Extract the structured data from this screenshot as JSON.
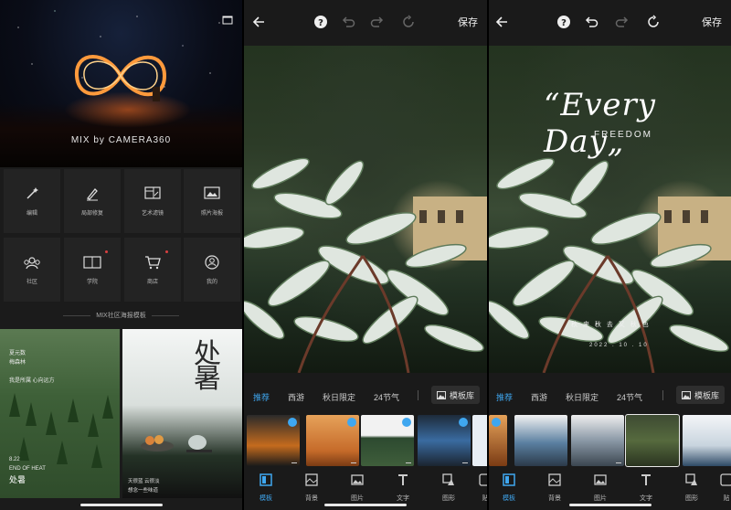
{
  "home": {
    "brand": "MIX by CAMERA360",
    "tools": [
      {
        "label": "编辑",
        "icon": "magic-wand-icon"
      },
      {
        "label": "局部修复",
        "icon": "brush-icon"
      },
      {
        "label": "艺术滤镜",
        "icon": "art-filter-icon"
      },
      {
        "label": "照片海报",
        "icon": "photo-poster-icon"
      },
      {
        "label": "社区",
        "icon": "community-icon"
      },
      {
        "label": "学院",
        "icon": "book-icon"
      },
      {
        "label": "商店",
        "icon": "cart-icon"
      },
      {
        "label": "我的",
        "icon": "profile-icon"
      }
    ],
    "section_title": "MIX社区海报模板",
    "poster_left": {
      "line1": "夏元数",
      "line2": "梅森林",
      "line3": "我是所属 心向远方",
      "date": "8.22",
      "english": "END OF HEAT",
      "big": "处暑"
    },
    "poster_right": {
      "callig": "处暑",
      "line1": "天很蓝 云很淡",
      "line2": "想念一些味道"
    }
  },
  "editor": {
    "save_label": "保存",
    "tabs": [
      "推荐",
      "西游",
      "秋日限定",
      "24节气"
    ],
    "library_label": "模板库",
    "bottom": [
      "模板",
      "背景",
      "图片",
      "文字",
      "图形",
      "贴"
    ]
  },
  "overlay": {
    "title": "“Every Day„",
    "subtitle": "FREEDOM",
    "poem": "秋 来 秋 去 又 秋 色",
    "poem2": "2022 . 10 . 10"
  },
  "colors": {
    "accent": "#3fa7f0",
    "glow": "#ff7a2a",
    "notify": "#d94040"
  }
}
